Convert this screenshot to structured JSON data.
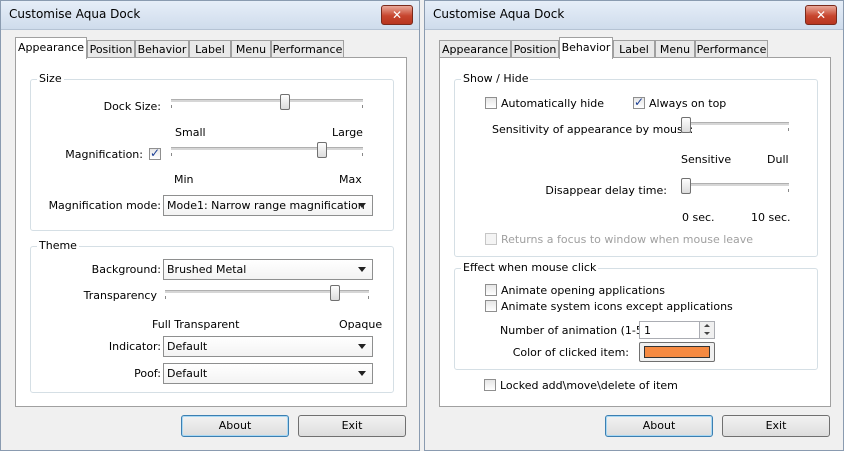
{
  "left": {
    "title": "Customise Aqua Dock",
    "close": "✕",
    "tabs": [
      {
        "label": "Appearance",
        "active": true
      },
      {
        "label": "Position"
      },
      {
        "label": "Behavior"
      },
      {
        "label": "Label"
      },
      {
        "label": "Menu"
      },
      {
        "label": "Performance"
      }
    ],
    "size_group": {
      "label": "Size",
      "dock_size_label": "Dock Size:",
      "dock_size_value": 0.6,
      "small": "Small",
      "large": "Large",
      "magnification_label": "Magnification:",
      "magnification_checked": true,
      "magnification_value": 0.8,
      "min": "Min",
      "max": "Max",
      "mode_label": "Magnification mode:",
      "mode_value": "Mode1: Narrow range magnification"
    },
    "theme_group": {
      "label": "Theme",
      "background_label": "Background:",
      "background_value": "Brushed Metal",
      "transparency_label": "Transparency",
      "transparency_value": 0.85,
      "full_transparent": "Full Transparent",
      "opaque": "Opaque",
      "indicator_label": "Indicator:",
      "indicator_value": "Default",
      "poof_label": "Poof:",
      "poof_value": "Default"
    },
    "about": "About",
    "exit": "Exit"
  },
  "right": {
    "title": "Customise Aqua Dock",
    "close": "✕",
    "tabs": [
      {
        "label": "Appearance"
      },
      {
        "label": "Position"
      },
      {
        "label": "Behavior",
        "active": true
      },
      {
        "label": "Label"
      },
      {
        "label": "Menu"
      },
      {
        "label": "Performance"
      }
    ],
    "show_hide": {
      "label": "Show / Hide",
      "auto_hide": "Automatically hide",
      "auto_hide_checked": false,
      "always_on_top": "Always on top",
      "always_on_top_checked": true,
      "sensitivity_label": "Sensitivity of appearance by mouse:",
      "sensitivity_value": 0.0,
      "sensitive": "Sensitive",
      "dull": "Dull",
      "delay_label": "Disappear delay time:",
      "delay_value": 0.0,
      "zero_sec": "0 sec.",
      "ten_sec": "10 sec.",
      "returns_focus": "Returns a focus to window when mouse leave",
      "returns_focus_enabled": false
    },
    "effect": {
      "label": "Effect when mouse click",
      "animate_opening": "Animate opening applications",
      "animate_opening_checked": false,
      "animate_system": "Animate system icons except applications",
      "animate_system_checked": false,
      "num_anim_label": "Number of animation (1-5):",
      "num_anim_value": "1",
      "color_label": "Color of clicked item:",
      "color_value": "#f58a42"
    },
    "locked": "Locked add\\move\\delete of item",
    "locked_checked": false,
    "about": "About",
    "exit": "Exit"
  }
}
